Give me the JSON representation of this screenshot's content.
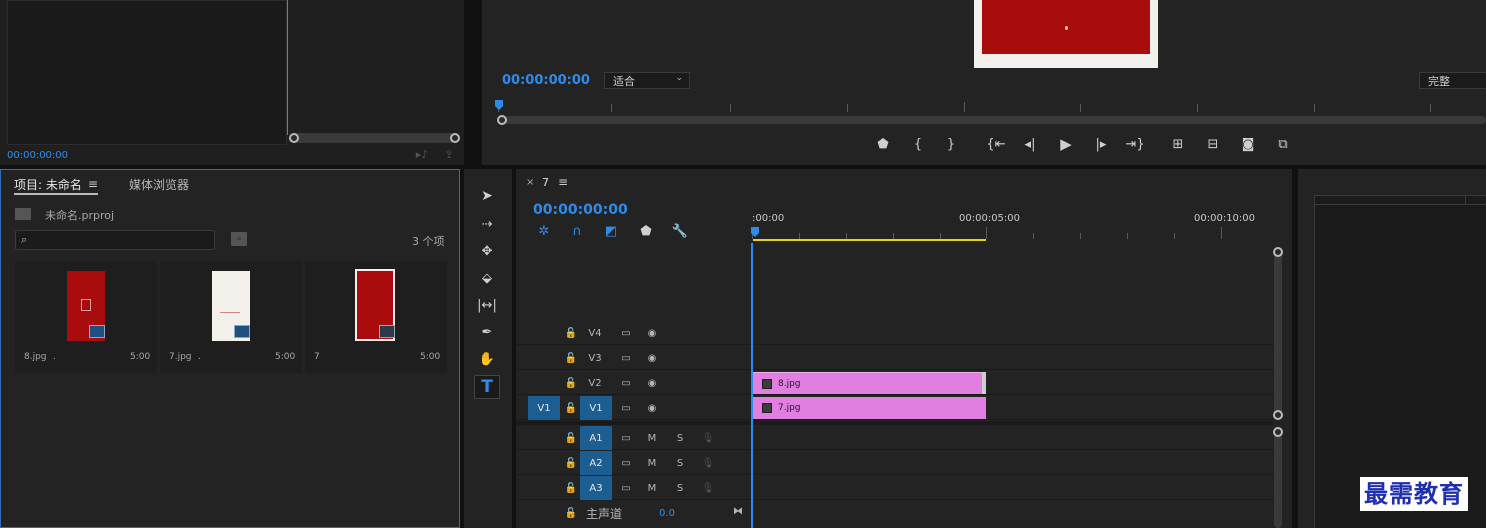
{
  "source_monitor": {
    "timecode": "00:00:00:00"
  },
  "program_monitor": {
    "timecode": "00:00:00:00",
    "fit_label": "适合",
    "quality_label": "完整"
  },
  "project_panel": {
    "tab_project": "项目: 未命名",
    "tab_media": "媒体浏览器",
    "project_file": "未命名.prproj",
    "search_placeholder": "",
    "item_count": "3 个项",
    "items": [
      {
        "name": "8.jpg",
        "extra": ".",
        "duration": "5:00"
      },
      {
        "name": "7.jpg",
        "extra": ".",
        "duration": "5:00"
      },
      {
        "name": "7",
        "extra": "",
        "duration": "5:00"
      }
    ]
  },
  "timeline": {
    "sequence_name": "7",
    "timecode": "00:00:00:00",
    "ruler_labels": [
      ":00:00",
      "00:00:05:00",
      "00:00:10:00"
    ],
    "tracks": {
      "v4": "V4",
      "v3": "V3",
      "v2": "V2",
      "v1_source": "V1",
      "v1": "V1",
      "a1": "A1",
      "a2": "A2",
      "a3": "A3"
    },
    "audio_m": "M",
    "audio_s": "S",
    "master_label": "主声道",
    "master_value": "0.0",
    "clips": [
      {
        "name": "8.jpg",
        "track": "V2"
      },
      {
        "name": "7.jpg",
        "track": "V1"
      }
    ]
  },
  "watermark": "最需教育",
  "colors": {
    "accent": "#2d8ceb",
    "clip": "#e17fe0",
    "poster_red": "#a80c0c",
    "work_area": "#e6d21c"
  }
}
